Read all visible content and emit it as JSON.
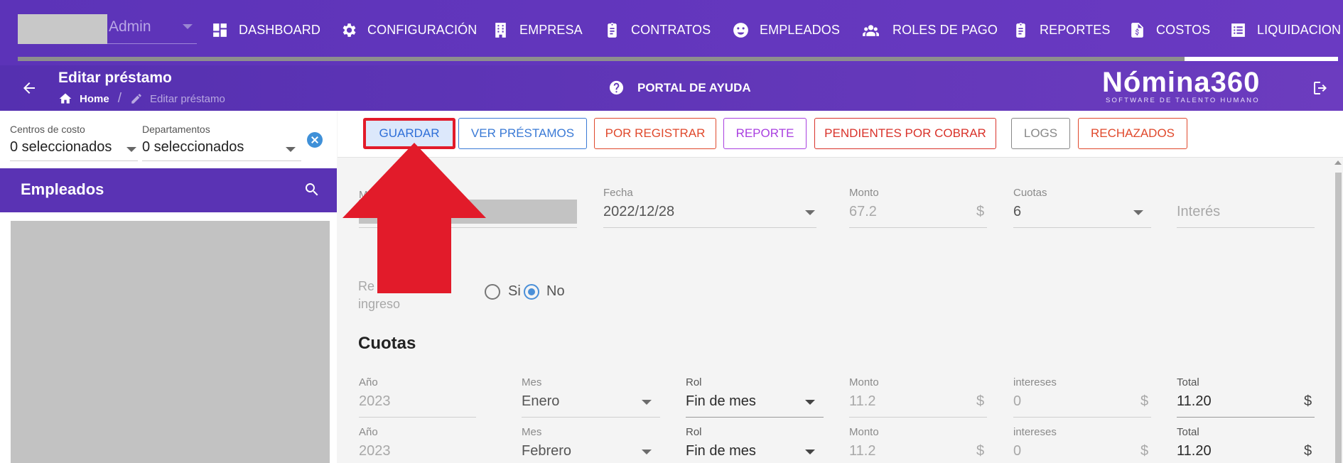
{
  "nav": {
    "admin_label": "Admin",
    "items": [
      {
        "label": "DASHBOARD",
        "icon": "dashboard-icon"
      },
      {
        "label": "CONFIGURACIÓN",
        "icon": "gear-icon"
      },
      {
        "label": "EMPRESA",
        "icon": "building-icon"
      },
      {
        "label": "CONTRATOS",
        "icon": "clipboard-icon"
      },
      {
        "label": "EMPLEADOS",
        "icon": "face-icon"
      },
      {
        "label": "ROLES DE PAGO",
        "icon": "people-icon"
      },
      {
        "label": "REPORTES",
        "icon": "clipboard-icon"
      },
      {
        "label": "COSTOS",
        "icon": "invoice-icon"
      },
      {
        "label": "LIQUIDACIONES",
        "icon": "list-icon"
      }
    ]
  },
  "subheader": {
    "title": "Editar préstamo",
    "breadcrumb_home": "Home",
    "breadcrumb_separator": "/",
    "breadcrumb_current": "Editar préstamo",
    "help_label": "PORTAL DE AYUDA",
    "brand_name": "Nómina360",
    "brand_tagline": "SOFTWARE DE TALENTO HUMANO"
  },
  "sidebar": {
    "cost_centers_label": "Centros de costo",
    "cost_centers_value": "0 seleccionados",
    "departments_label": "Departamentos",
    "departments_value": "0 seleccionados",
    "employees_title": "Empleados"
  },
  "toolbar": {
    "buttons": [
      {
        "label": "GUARDAR",
        "color": "#2f6fd8"
      },
      {
        "label": "VER PRÉSTAMOS",
        "color": "#3a7ad6"
      },
      {
        "label": "POR REGISTRAR",
        "color": "#e0492c"
      },
      {
        "label": "REPORTE",
        "color": "#a93fe0"
      },
      {
        "label": "PENDIENTES POR COBRAR",
        "color": "#d9322a"
      },
      {
        "label": "LOGS",
        "color": "#888888"
      },
      {
        "label": "RECHAZADOS",
        "color": "#e0492c"
      }
    ]
  },
  "form": {
    "motive_label_visible": "M",
    "fecha_label": "Fecha",
    "fecha_value": "2022/12/28",
    "monto_label": "Monto",
    "monto_value": "67.2",
    "currency": "$",
    "cuotas_label": "Cuotas",
    "cuotas_value": "6",
    "interes_placeholder": "Interés",
    "reflect_label_line1": "Re",
    "reflect_label_line2": "ingreso",
    "radio_si": "Si",
    "radio_no": "No",
    "radio_selected": "No"
  },
  "cuotas": {
    "title": "Cuotas",
    "col_labels": {
      "anio": "Año",
      "mes": "Mes",
      "rol": "Rol",
      "monto": "Monto",
      "intereses": "intereses",
      "total": "Total"
    },
    "rows": [
      {
        "anio": "2023",
        "mes": "Enero",
        "rol": "Fin de mes",
        "monto": "11.2",
        "intereses": "0",
        "total": "11.20"
      },
      {
        "anio": "2023",
        "mes": "Febrero",
        "rol": "Fin de mes",
        "monto": "11.2",
        "intereses": "0",
        "total": "11.20"
      }
    ]
  },
  "colors": {
    "nav_purple": "#6a3ac2",
    "subheader_purple": "#5a33b4",
    "annotation_red": "#e21b2a"
  }
}
